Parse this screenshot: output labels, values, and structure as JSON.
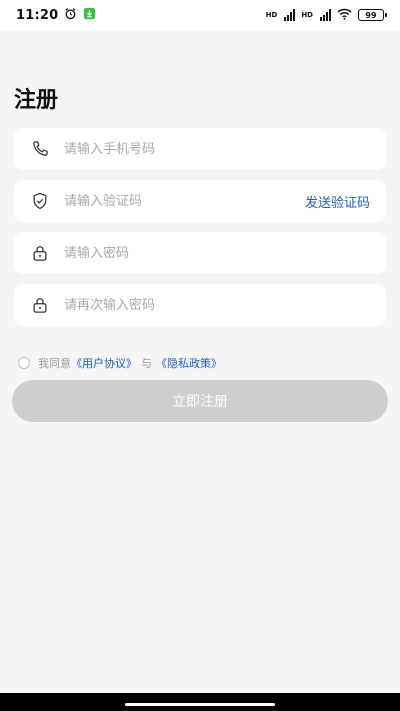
{
  "status_bar": {
    "time": "11:20",
    "battery": "99",
    "hd_label": "HD"
  },
  "page": {
    "title": "注册"
  },
  "form": {
    "phone_placeholder": "请输入手机号码",
    "code_placeholder": "请输入验证码",
    "send_code_label": "发送验证码",
    "password_placeholder": "请输入密码",
    "confirm_password_placeholder": "请再次输入密码"
  },
  "agreement": {
    "prefix": "我同意",
    "user_agreement": "《用户协议》",
    "connector": "与",
    "privacy_policy": "《隐私政策》"
  },
  "submit_label": "立即注册",
  "colors": {
    "link": "#1f5fb5",
    "background": "#f5f5f5",
    "button_disabled": "#cfcfcf"
  },
  "icons": [
    "alarm-icon",
    "download-icon",
    "signal-icon",
    "wifi-icon",
    "battery-icon",
    "phone-icon",
    "shield-icon",
    "lock-icon"
  ]
}
